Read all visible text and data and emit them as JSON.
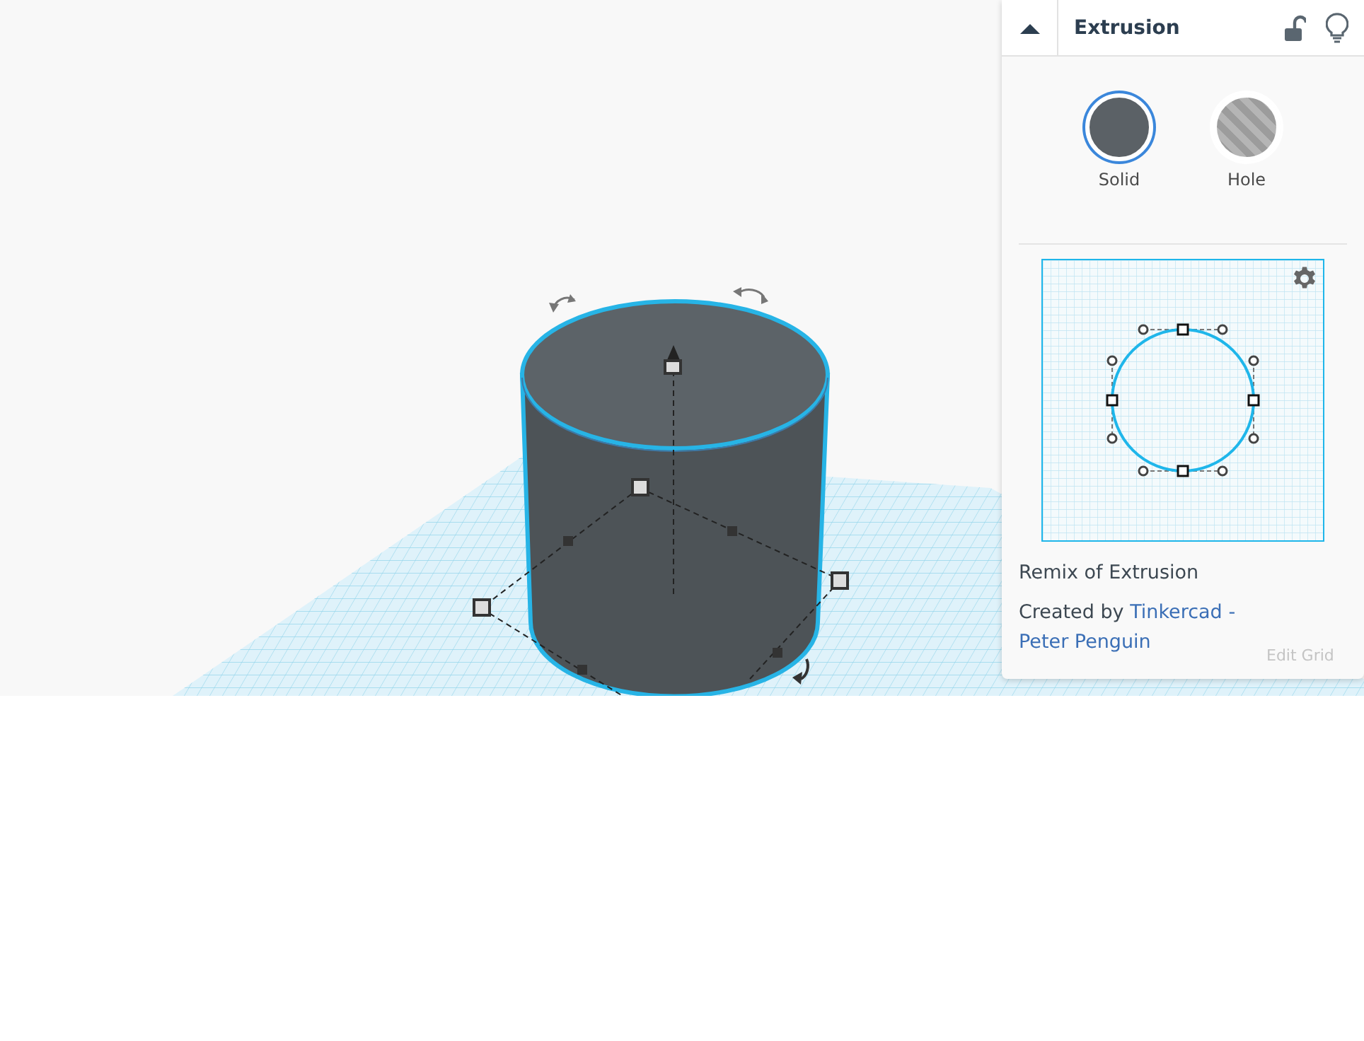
{
  "panel": {
    "title": "Extrusion",
    "locked": false,
    "modes": [
      {
        "label": "Solid",
        "kind": "solid",
        "selected": true
      },
      {
        "label": "Hole",
        "kind": "hole",
        "selected": false
      }
    ],
    "remix_text": "Remix of Extrusion",
    "credit": {
      "prefix": "Created by",
      "author": "Tinkercad",
      "separator": "-",
      "user": "Peter Penguin"
    }
  },
  "edit_grid_button": "Edit Grid"
}
